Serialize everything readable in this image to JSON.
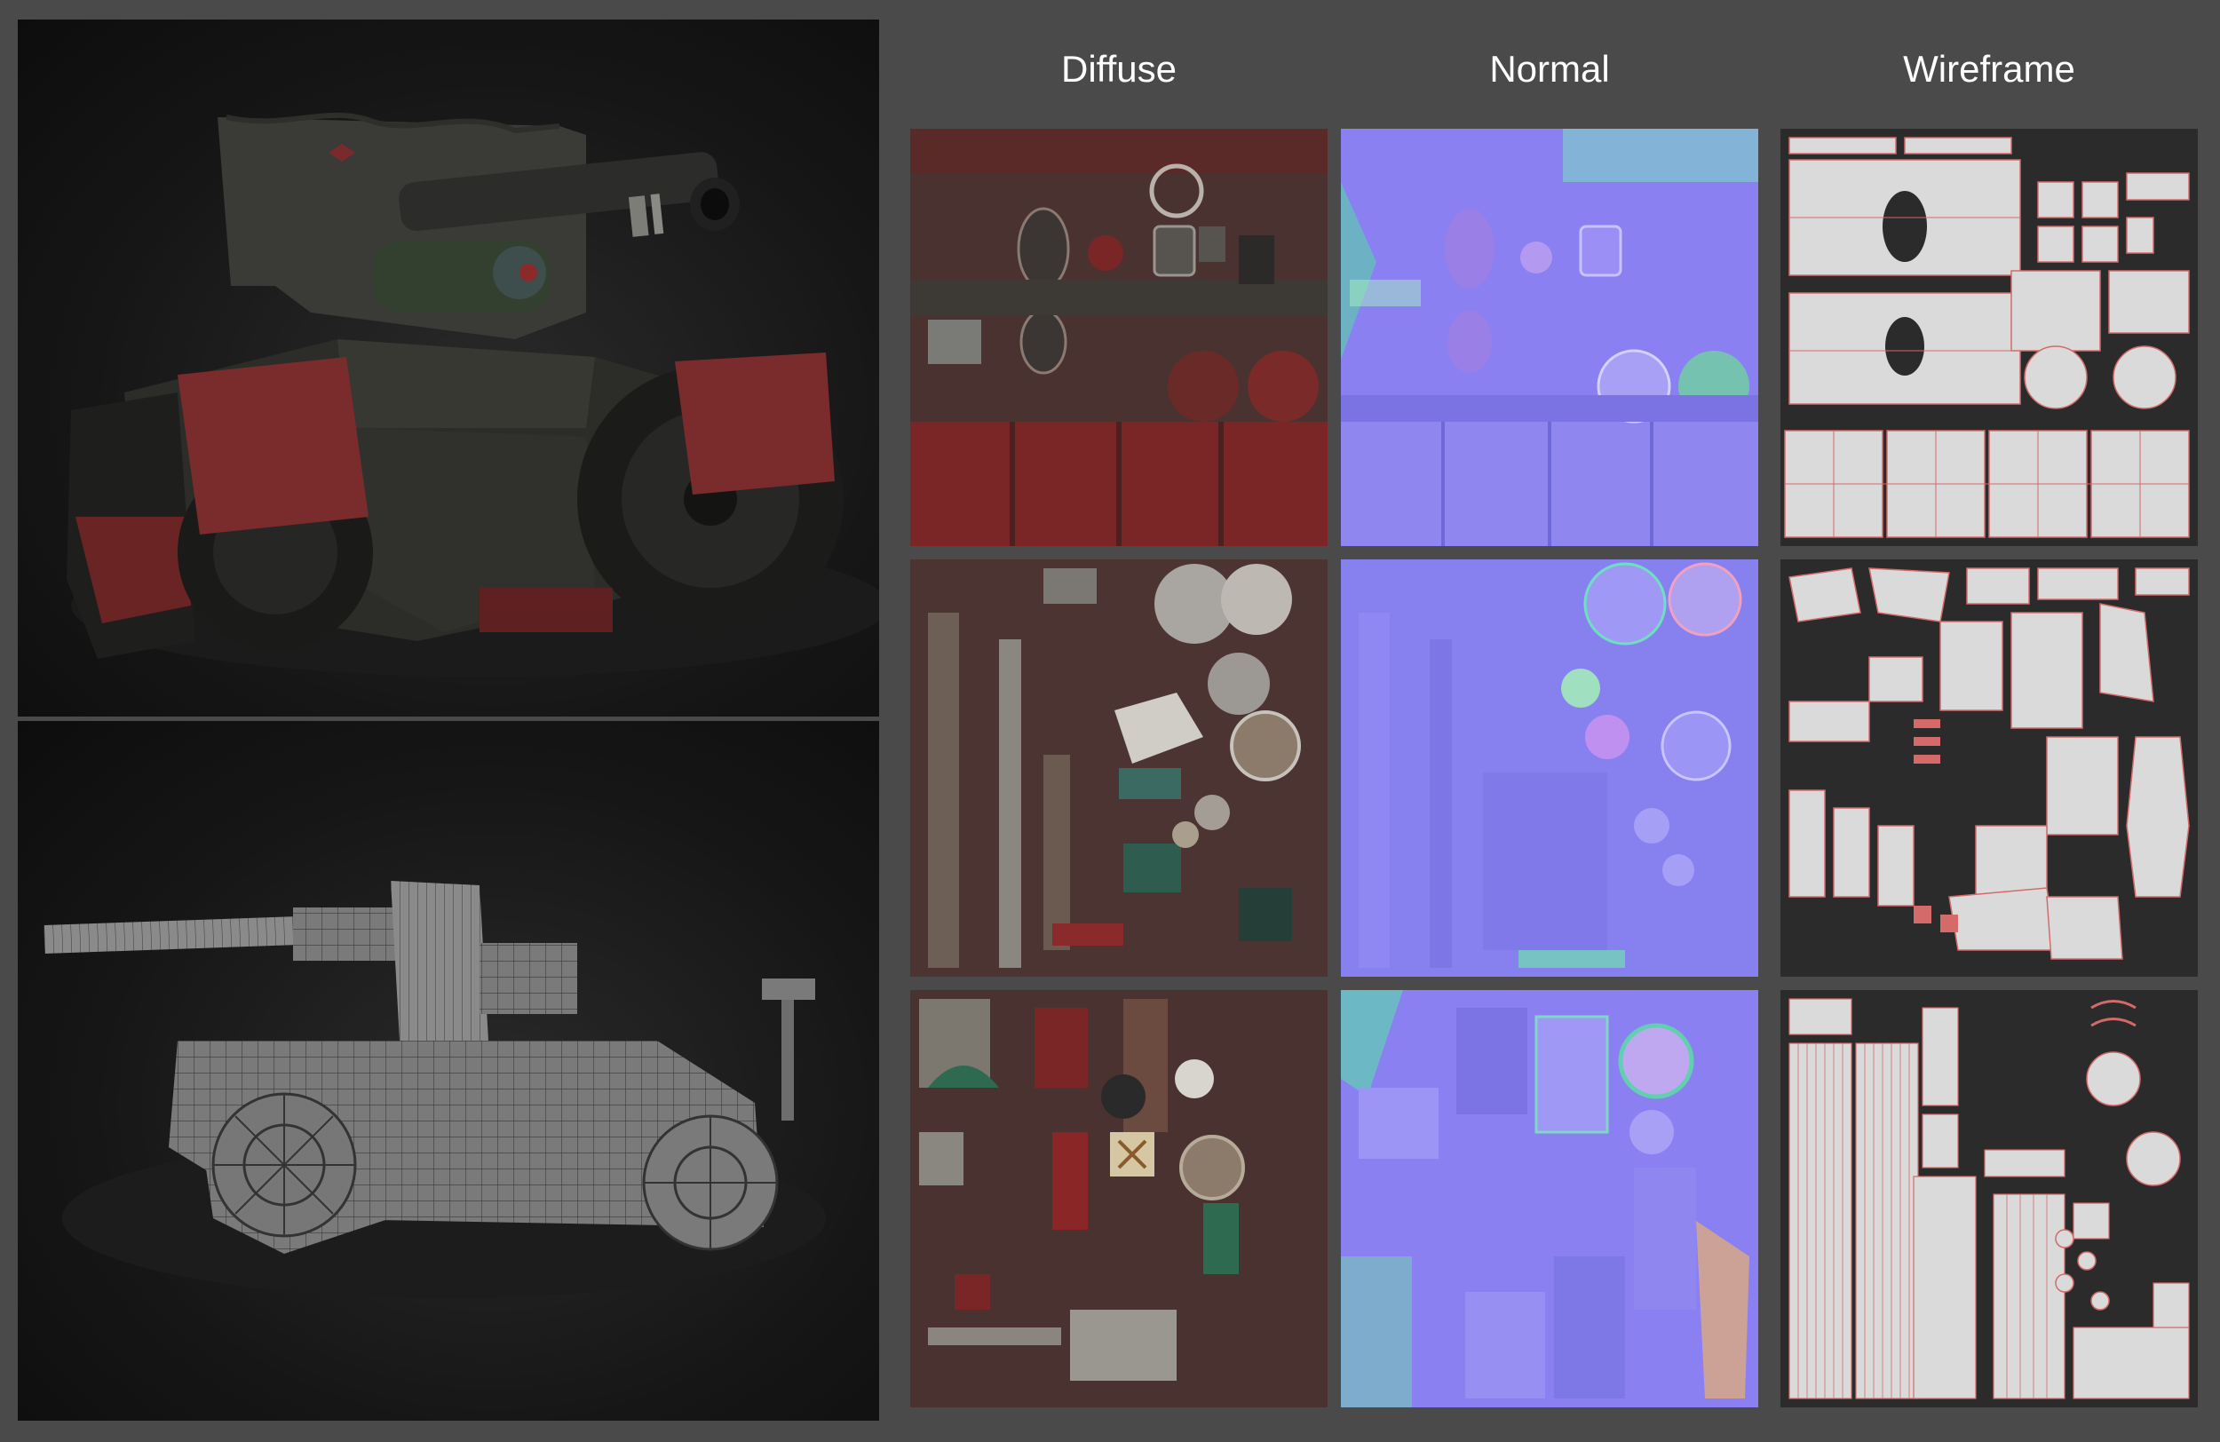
{
  "columns": {
    "diffuse": "Diffuse",
    "normal": "Normal",
    "wireframe": "Wireframe"
  },
  "colors": {
    "page_background": "#4a4a4a",
    "diffuse_base": "#4a3230",
    "diffuse_red": "#7a2626",
    "normal_base": "#8a80f2",
    "wire_base": "#2b2b2b",
    "wire_island": "#dadada",
    "wire_edge": "#d46a6a"
  }
}
